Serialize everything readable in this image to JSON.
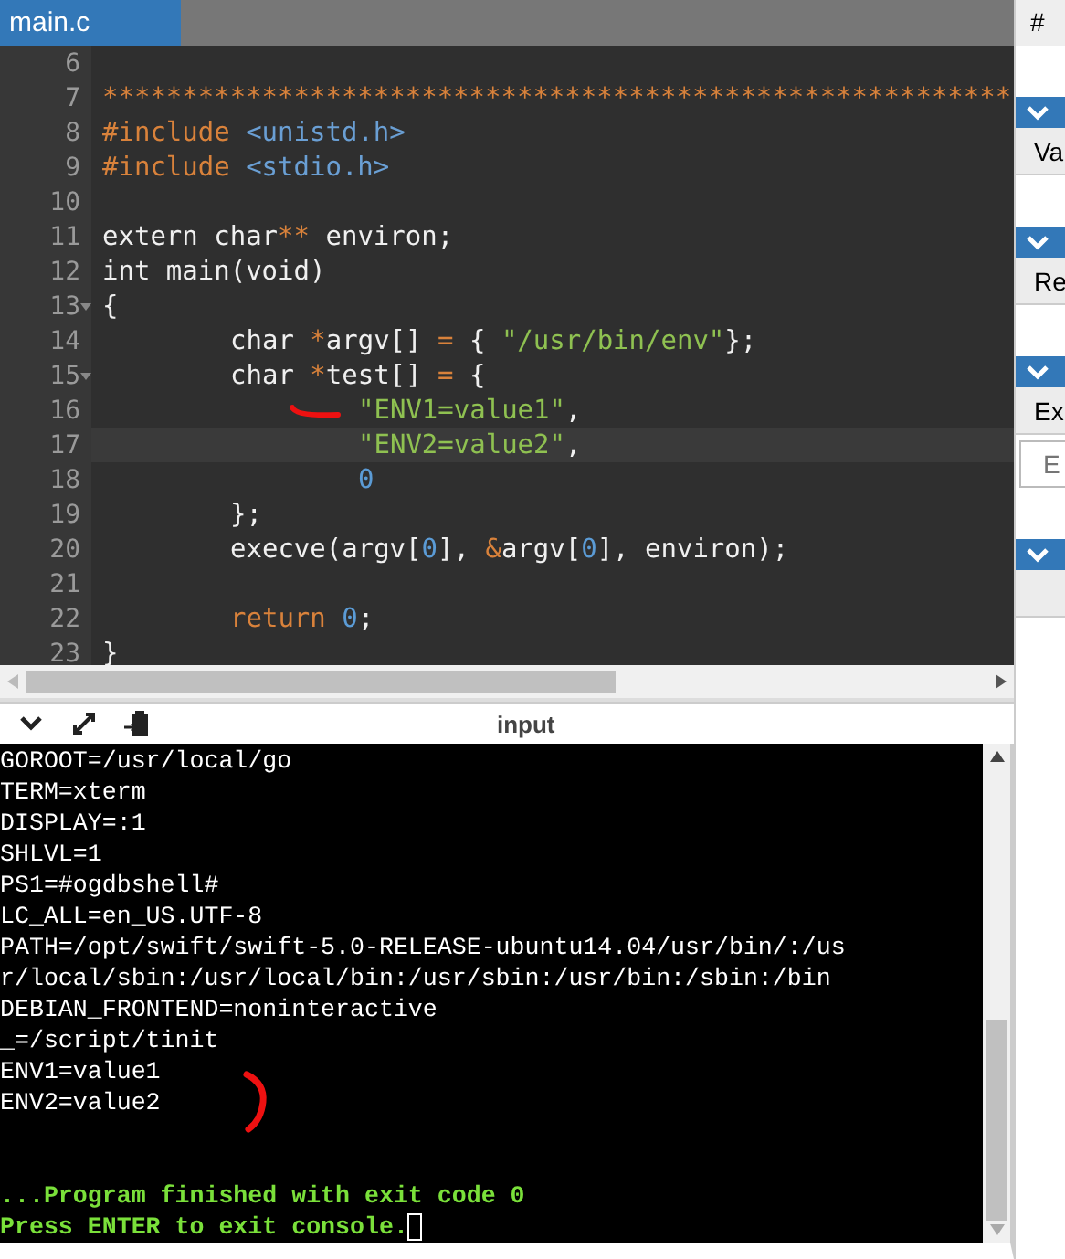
{
  "editor": {
    "tab": {
      "label": "main.c",
      "selected": true
    },
    "lines": [
      {
        "number": "6",
        "fold": false,
        "current": false
      },
      {
        "number": "7",
        "fold": false,
        "current": false,
        "kind": "top",
        "tokens": [
          {
            "text": "*********************************************************",
            "kind": "comment"
          }
        ]
      },
      {
        "number": "8",
        "fold": false,
        "current": false,
        "kind": "top",
        "tokens": [
          {
            "text": "#include",
            "kind": "keyword"
          },
          {
            "text": " <unistd.h>",
            "kind": "include"
          }
        ]
      },
      {
        "number": "9",
        "fold": false,
        "current": false,
        "kind": "top",
        "tokens": [
          {
            "text": "#include",
            "kind": "keyword"
          },
          {
            "text": " <stdio.h>",
            "kind": "include"
          }
        ]
      },
      {
        "number": "10",
        "fold": false,
        "current": false
      },
      {
        "number": "11",
        "fold": false,
        "current": false,
        "kind": "top",
        "tokens": [
          {
            "text": "extern char",
            "kind": "plain"
          },
          {
            "text": "**",
            "kind": "keyword"
          },
          {
            "text": " environ;",
            "kind": "plain"
          }
        ]
      },
      {
        "number": "12",
        "fold": false,
        "current": false,
        "kind": "top",
        "tokens": [
          {
            "text": "int main(void)",
            "kind": "plain"
          }
        ]
      },
      {
        "number": "13",
        "fold": true,
        "current": false,
        "kind": "top",
        "tokens": [
          {
            "text": "{",
            "kind": "plain"
          }
        ]
      },
      {
        "number": "14",
        "fold": false,
        "current": false,
        "kind": "block",
        "tokens": [
          {
            "text": "char ",
            "kind": "plain"
          },
          {
            "text": "*",
            "kind": "keyword"
          },
          {
            "text": "argv[] ",
            "kind": "plain"
          },
          {
            "text": "=",
            "kind": "keyword"
          },
          {
            "text": " { ",
            "kind": "plain"
          },
          {
            "text": "\"/usr/bin/env\"",
            "kind": "string"
          },
          {
            "text": "};",
            "kind": "plain"
          }
        ]
      },
      {
        "number": "15",
        "fold": true,
        "current": false,
        "kind": "block",
        "tokens": [
          {
            "text": "char ",
            "kind": "plain"
          },
          {
            "text": "*",
            "kind": "keyword"
          },
          {
            "text": "test[] ",
            "kind": "plain"
          },
          {
            "text": "=",
            "kind": "keyword"
          },
          {
            "text": " {",
            "kind": "plain"
          }
        ]
      },
      {
        "number": "16",
        "fold": false,
        "current": false,
        "kind": "inner",
        "tokens": [
          {
            "text": "\"ENV1=value1\"",
            "kind": "string"
          },
          {
            "text": ",",
            "kind": "plain"
          }
        ]
      },
      {
        "number": "17",
        "fold": false,
        "current": true,
        "kind": "inner",
        "tokens": [
          {
            "text": "\"ENV2=value2\"",
            "kind": "string"
          },
          {
            "text": ",",
            "kind": "plain"
          }
        ]
      },
      {
        "number": "18",
        "fold": false,
        "current": false,
        "kind": "inner",
        "tokens": [
          {
            "text": "0",
            "kind": "number"
          }
        ]
      },
      {
        "number": "19",
        "fold": false,
        "current": false,
        "kind": "block",
        "tokens": [
          {
            "text": "};",
            "kind": "plain"
          }
        ]
      },
      {
        "number": "20",
        "fold": false,
        "current": false,
        "kind": "block",
        "tokens": [
          {
            "text": "execve(argv[",
            "kind": "plain"
          },
          {
            "text": "0",
            "kind": "number"
          },
          {
            "text": "], ",
            "kind": "plain"
          },
          {
            "text": "&",
            "kind": "keyword"
          },
          {
            "text": "argv[",
            "kind": "plain"
          },
          {
            "text": "0",
            "kind": "number"
          },
          {
            "text": "], environ);",
            "kind": "plain"
          }
        ]
      },
      {
        "number": "21",
        "fold": false,
        "current": false
      },
      {
        "number": "22",
        "fold": false,
        "current": false,
        "kind": "block",
        "tokens": [
          {
            "text": "return",
            "kind": "keyword"
          },
          {
            "text": " 0",
            "kind": "number"
          },
          {
            "text": ";",
            "kind": "plain"
          }
        ]
      },
      {
        "number": "23",
        "fold": false,
        "current": false,
        "kind": "top",
        "tokens": [
          {
            "text": "}",
            "kind": "plain"
          }
        ]
      }
    ]
  },
  "console": {
    "title": "input",
    "output": [
      "GOROOT=/usr/local/go",
      "TERM=xterm",
      "DISPLAY=:1",
      "SHLVL=1",
      "PS1=#ogdbshell#",
      "LC_ALL=en_US.UTF-8",
      "PATH=/opt/swift/swift-5.0-RELEASE-ubuntu14.04/usr/bin/:/us",
      "r/local/sbin:/usr/local/bin:/usr/sbin:/usr/bin:/sbin:/bin",
      "DEBIAN_FRONTEND=noninteractive",
      "_=/script/tinit",
      "ENV1=value1",
      "ENV2=value2"
    ],
    "status": [
      "...Program finished with exit code 0",
      "Press ENTER to exit console."
    ],
    "cursor": true
  },
  "side_panel": {
    "header": "#",
    "sections": [
      {
        "kind": "label",
        "label": "Va"
      },
      {
        "kind": "label",
        "label": "Re"
      },
      {
        "kind": "field",
        "label": "Ex",
        "placeholder": "E"
      },
      {
        "kind": "empty"
      }
    ]
  }
}
